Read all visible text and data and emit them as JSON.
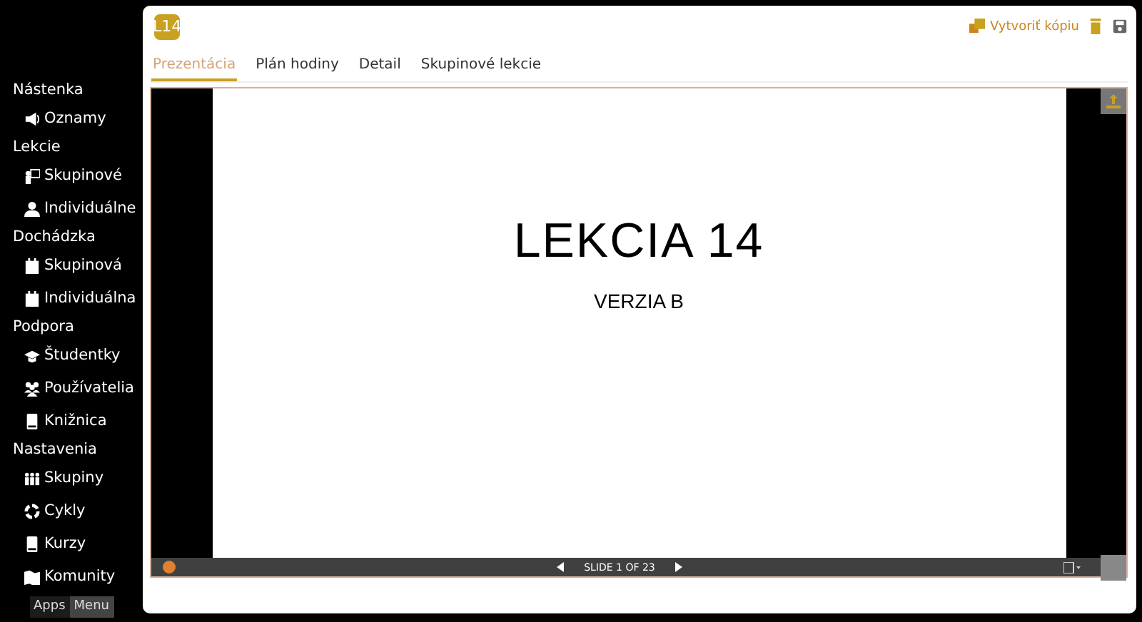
{
  "sidebar": {
    "sections": [
      {
        "heading": "Nástenka",
        "items": [
          {
            "label": "Oznamy"
          }
        ]
      },
      {
        "heading": "Lekcie",
        "items": [
          {
            "label": "Skupinové"
          },
          {
            "label": "Individuálne"
          }
        ]
      },
      {
        "heading": "Dochádzka",
        "items": [
          {
            "label": "Skupinová"
          },
          {
            "label": "Individuálna"
          }
        ]
      },
      {
        "heading": "Podpora",
        "items": [
          {
            "label": "Študentky"
          },
          {
            "label": "Používatelia"
          },
          {
            "label": "Knižnica"
          }
        ]
      },
      {
        "heading": "Nastavenia",
        "items": [
          {
            "label": "Skupiny"
          },
          {
            "label": "Cykly"
          },
          {
            "label": "Kurzy"
          },
          {
            "label": "Komunity"
          }
        ]
      }
    ],
    "switch": [
      {
        "label": "Apps",
        "selected": false
      },
      {
        "label": "Menu",
        "selected": true
      }
    ]
  },
  "header": {
    "badge": "L14",
    "copy_button": "Vytvoriť kópiu"
  },
  "tabs": [
    {
      "label": "Prezentácia",
      "selected": true
    },
    {
      "label": "Plán hodiny",
      "selected": false
    },
    {
      "label": "Detail",
      "selected": false
    },
    {
      "label": "Skupinové lekcie",
      "selected": false
    }
  ],
  "presentation": {
    "title": "LEKCIA 14",
    "subtitle": "VERZIA B",
    "counter": "SLIDE 1 OF 23"
  }
}
